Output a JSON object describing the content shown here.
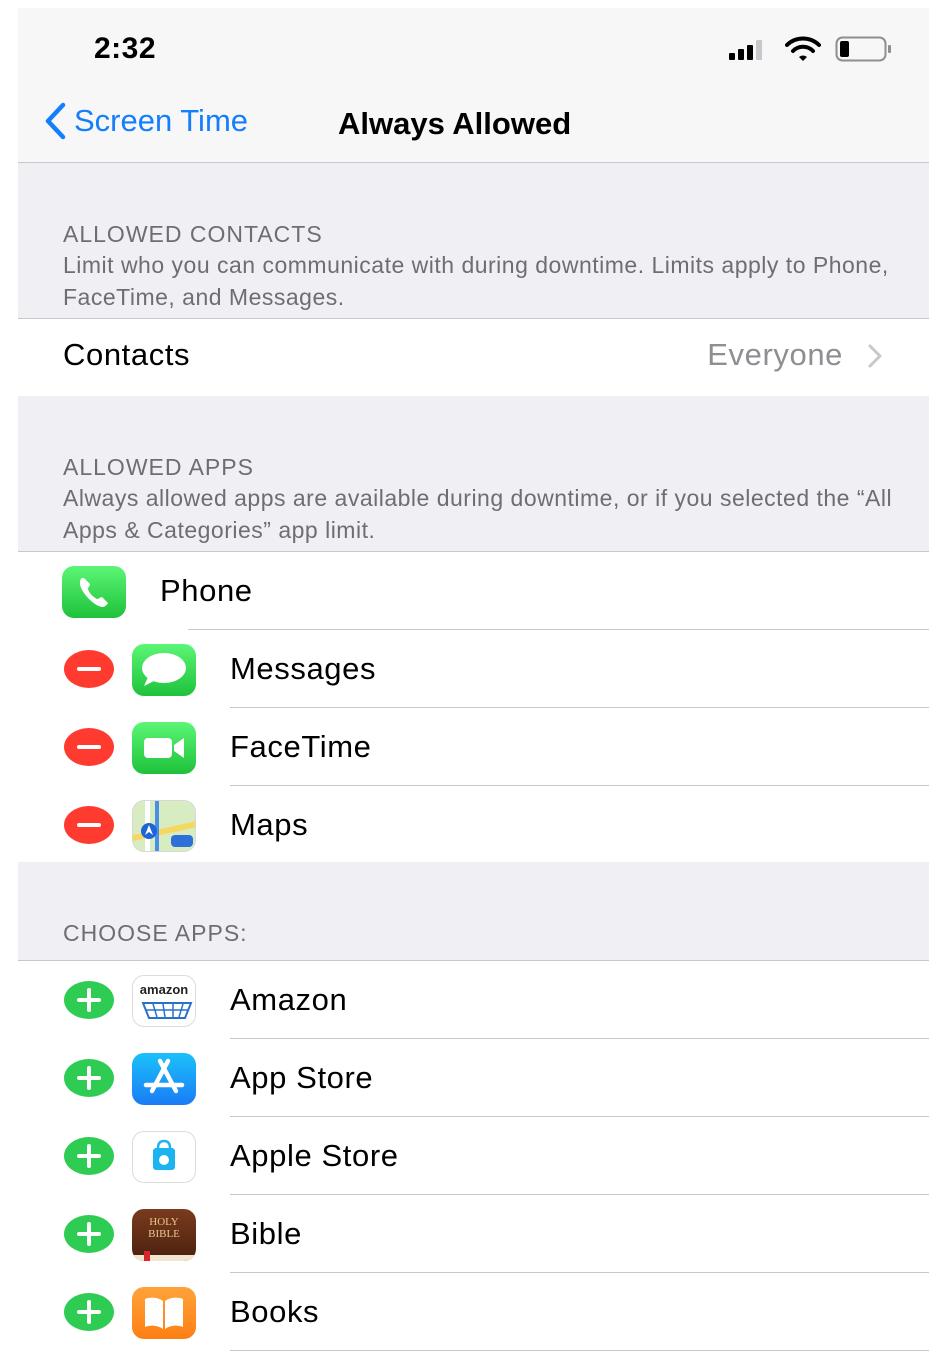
{
  "status_bar": {
    "time": "2:32"
  },
  "nav": {
    "back_label": "Screen Time",
    "title": "Always Allowed"
  },
  "allowed_contacts": {
    "header": "ALLOWED CONTACTS",
    "description": "Limit who you can communicate with during downtime. Limits apply to Phone, FaceTime, and Messages.",
    "row_label": "Contacts",
    "row_value": "Everyone"
  },
  "allowed_apps": {
    "header": "ALLOWED APPS",
    "description": "Always allowed apps are available during downtime, or if you selected the “All Apps & Categories” app limit.",
    "items": [
      {
        "name": "Phone",
        "icon": "phone-icon",
        "removable": false
      },
      {
        "name": "Messages",
        "icon": "messages-icon",
        "removable": true
      },
      {
        "name": "FaceTime",
        "icon": "facetime-icon",
        "removable": true
      },
      {
        "name": "Maps",
        "icon": "maps-icon",
        "removable": true
      }
    ]
  },
  "choose_apps": {
    "header": "CHOOSE APPS:",
    "items": [
      {
        "name": "Amazon",
        "icon": "amazon-icon",
        "icon_text": "amazon"
      },
      {
        "name": "App Store",
        "icon": "app-store-icon"
      },
      {
        "name": "Apple Store",
        "icon": "apple-store-icon"
      },
      {
        "name": "Bible",
        "icon": "bible-icon",
        "icon_text_1": "HOLY",
        "icon_text_2": "BIBLE"
      },
      {
        "name": "Books",
        "icon": "books-icon"
      }
    ]
  },
  "colors": {
    "ios_blue": "#157efb",
    "delete_red": "#ff3b30",
    "add_green": "#2ecc52",
    "group_background": "#efeff4",
    "secondary_text": "#6d6d72"
  }
}
